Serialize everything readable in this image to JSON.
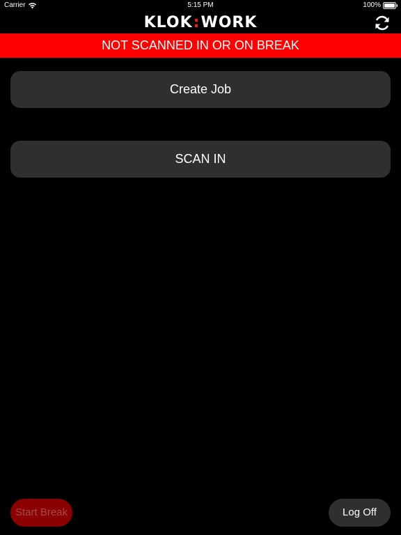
{
  "status_bar": {
    "carrier": "Carrier",
    "time": "5:15 PM",
    "battery": "100%"
  },
  "header": {
    "logo_left": "KLOK",
    "logo_sep": ":",
    "logo_right": "WORK",
    "refresh_icon": "refresh-icon"
  },
  "banner": {
    "text": "NOT SCANNED IN OR ON BREAK",
    "color": "#ff0000"
  },
  "actions": {
    "create_job": "Create Job",
    "scan_in": "SCAN IN"
  },
  "footer": {
    "start_break": "Start Break",
    "log_off": "Log Off"
  },
  "colors": {
    "background": "#000000",
    "button": "#2e3030",
    "accent_red": "#ff0000",
    "break_button": "#8b0000"
  }
}
